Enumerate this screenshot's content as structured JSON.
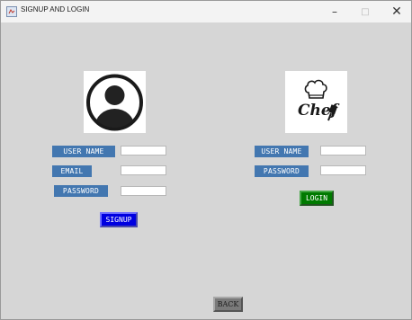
{
  "window": {
    "title": "SIGNUP AND LOGIN",
    "controls": {
      "minimize": "–",
      "maximize": "□",
      "close": "✕"
    }
  },
  "signup": {
    "image": "user-avatar-icon",
    "fields": [
      {
        "label": "USER NAME",
        "value": ""
      },
      {
        "label": "EMAIL",
        "value": ""
      },
      {
        "label": "PASSWORD",
        "value": ""
      }
    ],
    "button_label": "SIGNUP",
    "button_color": "#0000e0"
  },
  "login": {
    "image": "chef-logo",
    "logo_text": "Chef",
    "fields": [
      {
        "label": "USER NAME",
        "value": ""
      },
      {
        "label": "PASSWORD",
        "value": ""
      }
    ],
    "button_label": "LOGIN",
    "button_color": "#007a00"
  },
  "back_label": "BACK",
  "colors": {
    "label_bg": "#4377b0",
    "window_bg": "#d6d6d6"
  }
}
